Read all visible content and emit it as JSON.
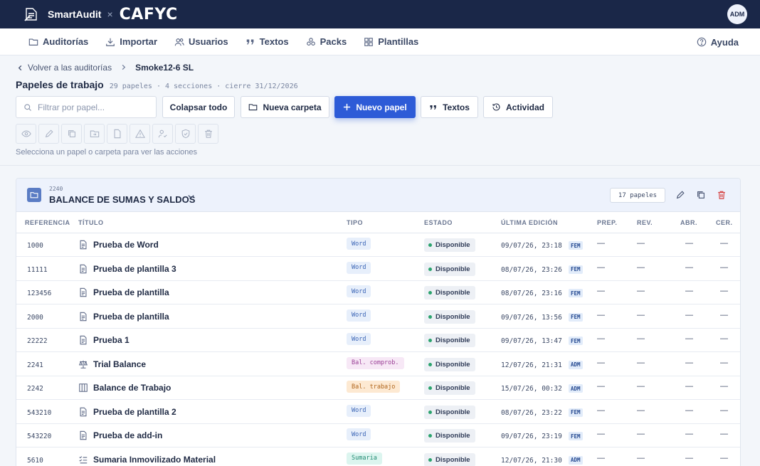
{
  "header": {
    "brand": "SmartAudit",
    "separator": "×",
    "partner": "CAFYC",
    "avatar": "ADM"
  },
  "nav": {
    "items": [
      {
        "label": "Auditorías",
        "icon": "folder-icon"
      },
      {
        "label": "Importar",
        "icon": "download-icon"
      },
      {
        "label": "Usuarios",
        "icon": "users-icon"
      },
      {
        "label": "Textos",
        "icon": "quote-icon"
      },
      {
        "label": "Packs",
        "icon": "packs-icon"
      },
      {
        "label": "Plantillas",
        "icon": "grid-icon"
      }
    ],
    "help": "Ayuda"
  },
  "breadcrumb": {
    "back": "Volver a las auditorías",
    "current": "Smoke12-6 SL"
  },
  "page": {
    "title": "Papeles de trabajo",
    "meta": "29 papeles · 4 secciones · cierre 31/12/2026"
  },
  "toolbar": {
    "search_placeholder": "Filtrar por papel...",
    "collapse": "Colapsar todo",
    "new_folder": "Nueva carpeta",
    "new_paper": "Nuevo papel",
    "texts": "Textos",
    "activity": "Actividad",
    "actions_hint": "Selecciona un papel o carpeta para ver las acciones",
    "action_icons": [
      "eye-icon",
      "pencil-icon",
      "copy-icon",
      "move-icon",
      "file-icon",
      "warning-icon",
      "assign-user-icon",
      "shield-icon",
      "trash-icon"
    ]
  },
  "folder": {
    "code": "2240",
    "name": "BALANCE DE SUMAS Y SALDOS",
    "count": "17 papeles"
  },
  "table": {
    "headers": {
      "ref": "REFERENCIA",
      "title": "TÍTULO",
      "type": "TIPO",
      "status": "ESTADO",
      "edited": "ÚLTIMA EDICIÓN",
      "prep": "PREP.",
      "rev": "REV.",
      "abr": "ABR.",
      "cer": "CER."
    },
    "rows": [
      {
        "ref": "1000",
        "title": "Prueba de Word",
        "icon": "document-icon",
        "type": "Word",
        "status": "Disponible",
        "date": "09/07/26, 23:18",
        "user": "FEM",
        "prep": "—",
        "rev": "—",
        "abr": "—",
        "cer": "—"
      },
      {
        "ref": "11111",
        "title": "Prueba de plantilla 3",
        "icon": "document-icon",
        "type": "Word",
        "status": "Disponible",
        "date": "08/07/26, 23:26",
        "user": "FEM",
        "prep": "—",
        "rev": "—",
        "abr": "—",
        "cer": "—"
      },
      {
        "ref": "123456",
        "title": "Prueba de plantilla",
        "icon": "document-icon",
        "type": "Word",
        "status": "Disponible",
        "date": "08/07/26, 23:16",
        "user": "FEM",
        "prep": "—",
        "rev": "—",
        "abr": "—",
        "cer": "—"
      },
      {
        "ref": "2000",
        "title": "Prueba de plantilla",
        "icon": "document-icon",
        "type": "Word",
        "status": "Disponible",
        "date": "09/07/26, 13:56",
        "user": "FEM",
        "prep": "—",
        "rev": "—",
        "abr": "—",
        "cer": "—"
      },
      {
        "ref": "22222",
        "title": "Prueba 1",
        "icon": "document-icon",
        "type": "Word",
        "status": "Disponible",
        "date": "09/07/26, 13:47",
        "user": "FEM",
        "prep": "—",
        "rev": "—",
        "abr": "—",
        "cer": "—"
      },
      {
        "ref": "2241",
        "title": "Trial Balance",
        "icon": "scale-icon",
        "type": "Bal. comprob.",
        "status": "Disponible",
        "date": "12/07/26, 21:31",
        "user": "ADM",
        "prep": "—",
        "rev": "—",
        "abr": "—",
        "cer": "—"
      },
      {
        "ref": "2242",
        "title": "Balance de Trabajo",
        "icon": "columns-icon",
        "type": "Bal. trabajo",
        "status": "Disponible",
        "date": "15/07/26, 00:32",
        "user": "ADM",
        "prep": "—",
        "rev": "—",
        "abr": "—",
        "cer": "—"
      },
      {
        "ref": "543210",
        "title": "Prueba de plantilla 2",
        "icon": "document-icon",
        "type": "Word",
        "status": "Disponible",
        "date": "08/07/26, 23:22",
        "user": "FEM",
        "prep": "—",
        "rev": "—",
        "abr": "—",
        "cer": "—"
      },
      {
        "ref": "543220",
        "title": "Prueba de add-in",
        "icon": "document-icon",
        "type": "Word",
        "status": "Disponible",
        "date": "09/07/26, 23:19",
        "user": "FEM",
        "prep": "—",
        "rev": "—",
        "abr": "—",
        "cer": "—"
      },
      {
        "ref": "5610",
        "title": "Sumaria Inmovilizado Material",
        "icon": "checklist-icon",
        "type": "Sumaria",
        "status": "Disponible",
        "date": "12/07/26, 21:30",
        "user": "ADM",
        "prep": "—",
        "rev": "—",
        "abr": "—",
        "cer": "—"
      }
    ]
  },
  "colors": {
    "topbar": "#1a2748",
    "primary": "#2d5bd7",
    "status_dot": "#2ba36e",
    "delete": "#d64545"
  }
}
